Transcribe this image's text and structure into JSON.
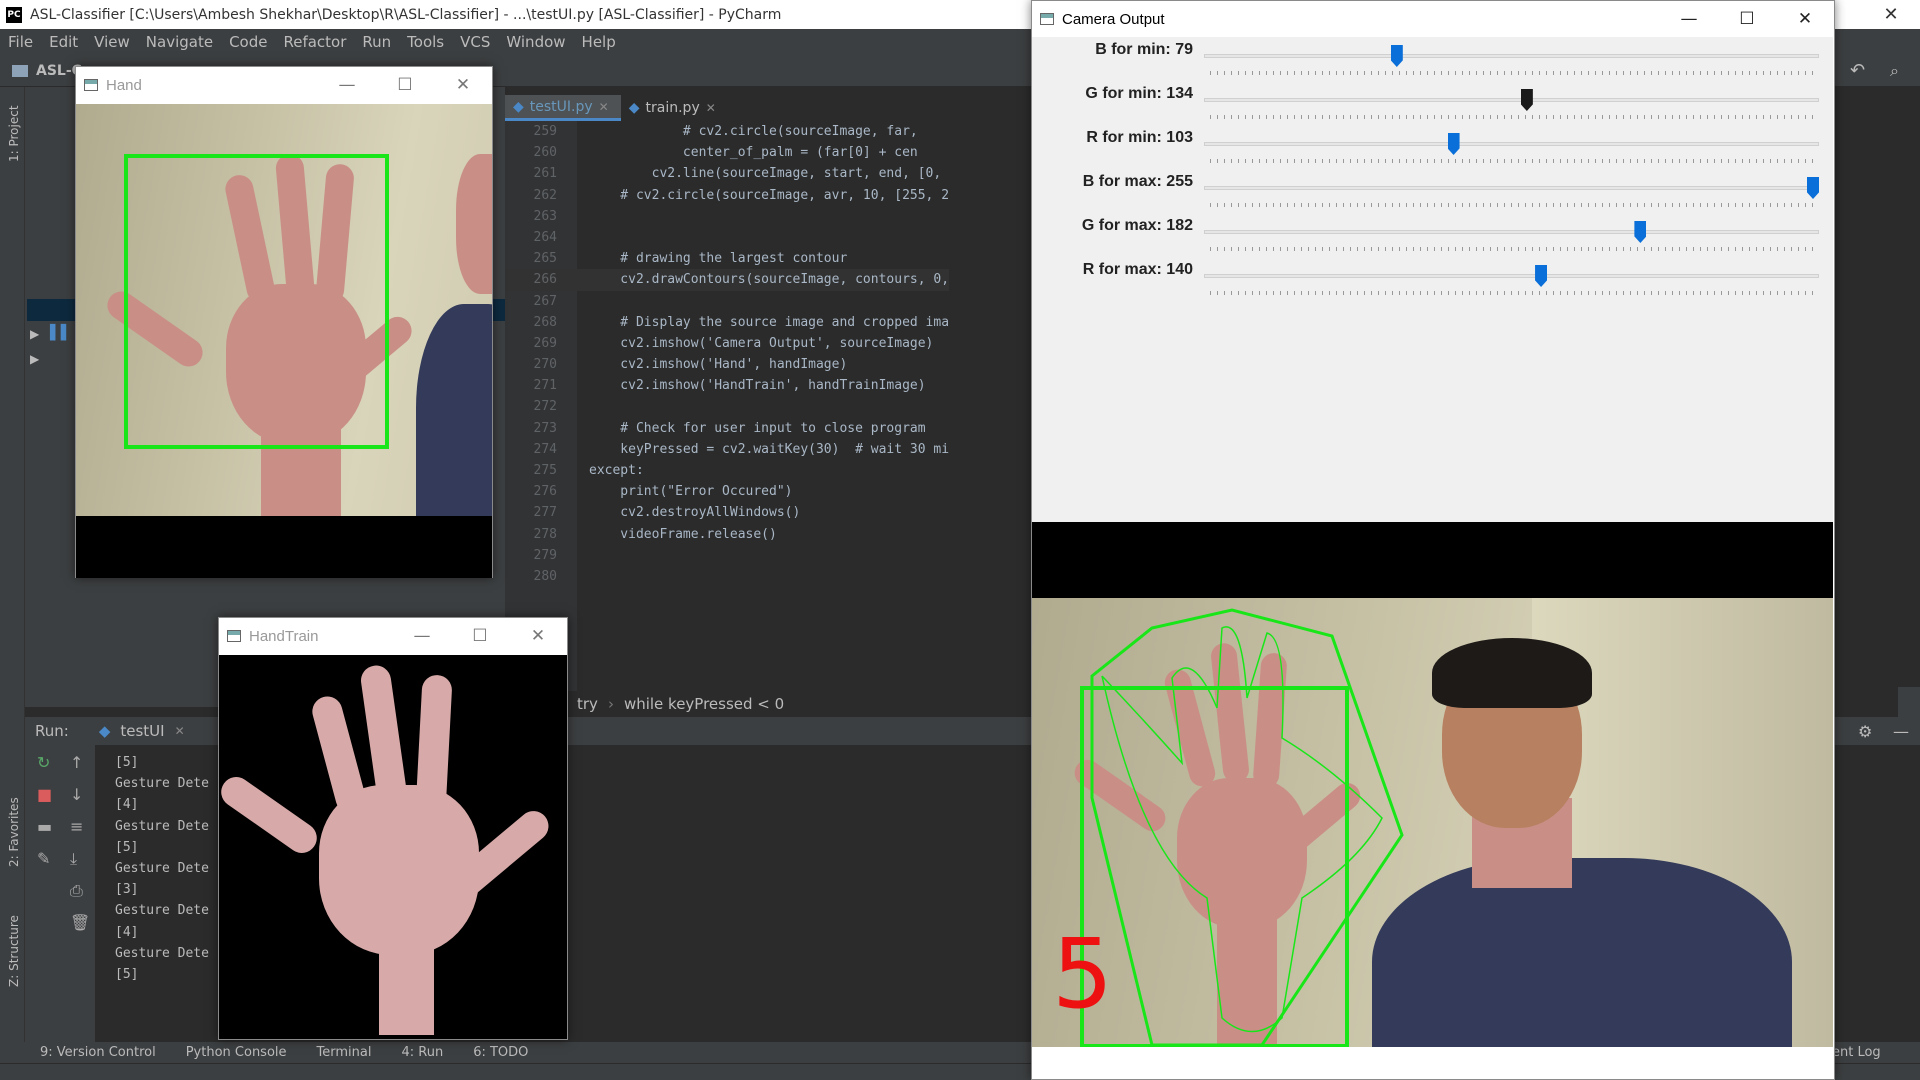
{
  "titlebar": {
    "title": "ASL-Classifier [C:\\Users\\Ambesh Shekhar\\Desktop\\R\\ASL-Classifier] - ...\\testUI.py [ASL-Classifier] - PyCharm",
    "logo": "PC"
  },
  "menu": [
    "File",
    "Edit",
    "View",
    "Navigate",
    "Code",
    "Refactor",
    "Run",
    "Tools",
    "VCS",
    "Window",
    "Help"
  ],
  "navbar": {
    "project": "ASL-C"
  },
  "left_strip": {
    "project": "1: Project",
    "favorites": "2: Favorites",
    "structure": "Z: Structure"
  },
  "tabs": [
    {
      "label": "testUI.py",
      "active": true
    },
    {
      "label": "train.py",
      "active": false
    }
  ],
  "code": [
    {
      "n": "259",
      "text": "            # cv2.circle(sourceImage, far, ",
      "kind": "comment"
    },
    {
      "n": "260",
      "text": "            center_of_palm = (far[0] + cen",
      "kind": "code"
    },
    {
      "n": "261",
      "text": "        cv2.line(sourceImage, start, end, [0, ",
      "kind": "code"
    },
    {
      "n": "262",
      "text": "    # cv2.circle(sourceImage, avr, 10, [255, 2",
      "kind": "comment"
    },
    {
      "n": "263",
      "text": "",
      "kind": "code"
    },
    {
      "n": "264",
      "text": "",
      "kind": "code"
    },
    {
      "n": "265",
      "text": "    # drawing the largest contour",
      "kind": "comment"
    },
    {
      "n": "266",
      "text": "    cv2.drawContours(sourceImage, contours, 0,",
      "kind": "current"
    },
    {
      "n": "267",
      "text": "",
      "kind": "code"
    },
    {
      "n": "268",
      "text": "    # Display the source image and cropped ima",
      "kind": "comment"
    },
    {
      "n": "269",
      "text": "    cv2.imshow('Camera Output', sourceImage)",
      "kind": "code"
    },
    {
      "n": "270",
      "text": "    cv2.imshow('Hand', handImage)",
      "kind": "code"
    },
    {
      "n": "271",
      "text": "    cv2.imshow('HandTrain', handTrainImage)",
      "kind": "code"
    },
    {
      "n": "272",
      "text": "",
      "kind": "code"
    },
    {
      "n": "273",
      "text": "    # Check for user input to close program",
      "kind": "comment"
    },
    {
      "n": "274",
      "text": "    keyPressed = cv2.waitKey(30)  # wait 30 mi",
      "kind": "code"
    },
    {
      "n": "275",
      "text": "except:",
      "kind": "keyword"
    },
    {
      "n": "276",
      "text": "    print(\"Error Occured\")",
      "kind": "code"
    },
    {
      "n": "277",
      "text": "    cv2.destroyAllWindows()",
      "kind": "code"
    },
    {
      "n": "278",
      "text": "    videoFrame.release()",
      "kind": "code"
    },
    {
      "n": "279",
      "text": "",
      "kind": "code"
    },
    {
      "n": "280",
      "text": "",
      "kind": "code"
    }
  ],
  "breadcrumb": [
    "try",
    "while keyPressed < 0"
  ],
  "run": {
    "label": "Run:",
    "config": "testUI",
    "output": [
      "[5]",
      "Gesture Dete",
      "[4]",
      "Gesture Dete",
      "[5]",
      "Gesture Dete",
      "[3]",
      "Gesture Dete",
      "[4]",
      "Gesture Dete",
      "[5]"
    ]
  },
  "statusbar": [
    "9: Version Control",
    "Python Console",
    "Terminal",
    "4: Run",
    "6: TODO"
  ],
  "event_log": "ent Log",
  "windows": {
    "hand": {
      "title": "Hand"
    },
    "handtrain": {
      "title": "HandTrain"
    },
    "camera": {
      "title": "Camera Output"
    }
  },
  "trackbars": [
    {
      "label": "B for min: 79",
      "value": 79,
      "max": 255,
      "dark": false
    },
    {
      "label": "G for min: 134",
      "value": 134,
      "max": 255,
      "dark": true
    },
    {
      "label": "R for min: 103",
      "value": 103,
      "max": 255,
      "dark": false
    },
    {
      "label": "B for max: 255",
      "value": 255,
      "max": 255,
      "dark": false
    },
    {
      "label": "G for max: 182",
      "value": 182,
      "max": 255,
      "dark": false
    },
    {
      "label": "R for max: 140",
      "value": 140,
      "max": 255,
      "dark": false
    }
  ],
  "detected_digit": "5"
}
